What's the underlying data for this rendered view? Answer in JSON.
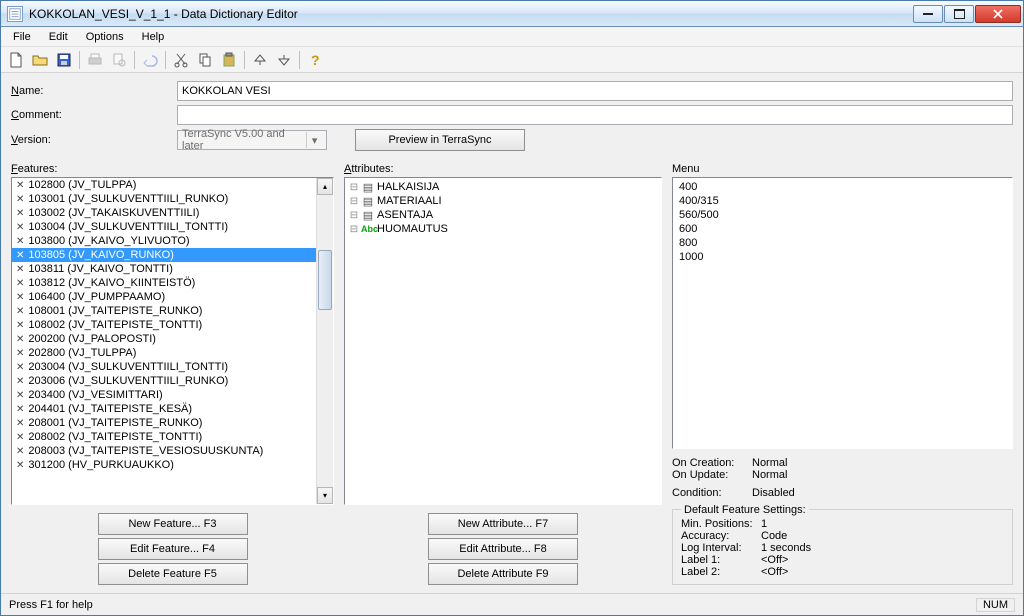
{
  "window": {
    "title": "KOKKOLAN_VESI_V_1_1 - Data Dictionary Editor"
  },
  "menubar": {
    "file": "File",
    "edit": "Edit",
    "options": "Options",
    "help": "Help"
  },
  "form": {
    "name_label": "Name:",
    "name_value": "KOKKOLAN VESI",
    "comment_label": "Comment:",
    "comment_value": "",
    "version_label": "Version:",
    "version_value": "TerraSync V5.00 and later",
    "preview_btn": "Preview in TerraSync"
  },
  "panels": {
    "features_label": "Features:",
    "attributes_label": "Attributes:",
    "menu_label": "Menu"
  },
  "features": [
    {
      "label": "102800 (JV_TULPPA)",
      "sel": false
    },
    {
      "label": "103001 (JV_SULKUVENTTIILI_RUNKO)",
      "sel": false
    },
    {
      "label": "103002 (JV_TAKAISKUVENTTIILI)",
      "sel": false
    },
    {
      "label": "103004 (JV_SULKUVENTTIILI_TONTTI)",
      "sel": false
    },
    {
      "label": "103800 (JV_KAIVO_YLIVUOTO)",
      "sel": false
    },
    {
      "label": "103805 (JV_KAIVO_RUNKO)",
      "sel": true
    },
    {
      "label": "103811 (JV_KAIVO_TONTTI)",
      "sel": false
    },
    {
      "label": "103812 (JV_KAIVO_KIINTEISTÖ)",
      "sel": false
    },
    {
      "label": "106400 (JV_PUMPPAAMO)",
      "sel": false
    },
    {
      "label": "108001 (JV_TAITEPISTE_RUNKO)",
      "sel": false
    },
    {
      "label": "108002 (JV_TAITEPISTE_TONTTI)",
      "sel": false
    },
    {
      "label": "200200 (VJ_PALOPOSTI)",
      "sel": false
    },
    {
      "label": "202800 (VJ_TULPPA)",
      "sel": false
    },
    {
      "label": "203004 (VJ_SULKUVENTTIILI_TONTTI)",
      "sel": false
    },
    {
      "label": "203006 (VJ_SULKUVENTTIILI_RUNKO)",
      "sel": false
    },
    {
      "label": "203400 (VJ_VESIMITTARI)",
      "sel": false
    },
    {
      "label": "204401 (VJ_TAITEPISTE_KESÄ)",
      "sel": false
    },
    {
      "label": "208001 (VJ_TAITEPISTE_RUNKO)",
      "sel": false
    },
    {
      "label": "208002 (VJ_TAITEPISTE_TONTTI)",
      "sel": false
    },
    {
      "label": "208003 (VJ_TAITEPISTE_VESIOSUUSKUNTA)",
      "sel": false
    },
    {
      "label": "301200 (HV_PURKUAUKKO)",
      "sel": false
    }
  ],
  "attributes": [
    {
      "label": "HALKAISIJA",
      "type": "menu"
    },
    {
      "label": "MATERIAALI",
      "type": "menu"
    },
    {
      "label": "ASENTAJA",
      "type": "menu"
    },
    {
      "label": "HUOMAUTUS",
      "type": "text"
    }
  ],
  "menu_values": [
    "400",
    "400/315",
    "560/500",
    "600",
    "800",
    "1000"
  ],
  "props": {
    "on_creation_l": "On Creation:",
    "on_creation_v": "Normal",
    "on_update_l": "On Update:",
    "on_update_v": "Normal",
    "condition_l": "Condition:",
    "condition_v": "Disabled"
  },
  "defaults": {
    "legend": "Default Feature Settings:",
    "min_pos_l": "Min. Positions:",
    "min_pos_v": "1",
    "accuracy_l": "Accuracy:",
    "accuracy_v": "Code",
    "log_l": "Log Interval:",
    "log_v": "1 seconds",
    "label1_l": "Label 1:",
    "label1_v": "<Off>",
    "label2_l": "Label 2:",
    "label2_v": "<Off>"
  },
  "buttons": {
    "new_feature": "New Feature... F3",
    "edit_feature": "Edit Feature... F4",
    "delete_feature": "Delete Feature F5",
    "new_attr": "New Attribute... F7",
    "edit_attr": "Edit Attribute... F8",
    "delete_attr": "Delete Attribute F9"
  },
  "status": {
    "help": "Press F1 for help",
    "num": "NUM"
  }
}
